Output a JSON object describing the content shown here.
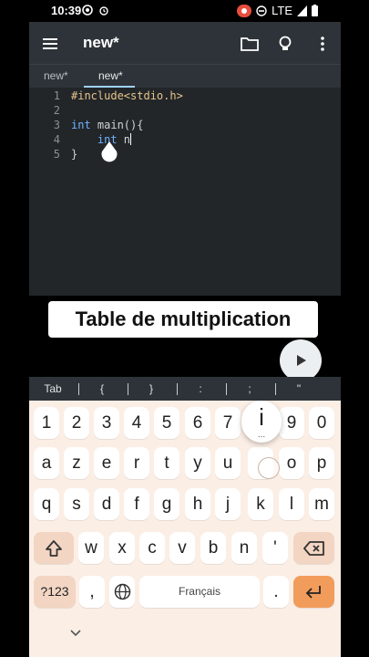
{
  "status_bar": {
    "time": "10:39",
    "network": "LTE",
    "icons": [
      "gear-icon",
      "alarm-icon",
      "record-icon",
      "dnd-icon",
      "signal-icon",
      "battery-icon"
    ]
  },
  "app": {
    "title": "new*",
    "toolbar_icons": [
      "menu-icon",
      "folder-icon",
      "lightbulb-icon",
      "more-vert-icon"
    ],
    "tabs": [
      {
        "label": "new*",
        "active": false
      },
      {
        "label": "new*",
        "active": true
      }
    ],
    "editor": {
      "line_numbers": [
        "1",
        "2",
        "3",
        "4",
        "5"
      ],
      "lines": [
        {
          "a": "#include<stdio.h>",
          "b": ""
        },
        {
          "a": "",
          "b": ""
        },
        {
          "a": "int",
          "b": " main(){"
        },
        {
          "a": "    int",
          "b": " n"
        },
        {
          "a": "",
          "b": "}"
        }
      ]
    }
  },
  "caption": "Table de multiplication",
  "run_button": {
    "icon": "play-icon"
  },
  "symbol_bar": {
    "items": [
      "Tab",
      "{",
      "}",
      ":",
      ";",
      "\""
    ]
  },
  "keyboard": {
    "row1": [
      "1",
      "2",
      "3",
      "4",
      "5",
      "6",
      "7",
      "8",
      "9",
      "0"
    ],
    "row2": [
      "a",
      "z",
      "e",
      "r",
      "t",
      "y",
      "u",
      "i",
      "o",
      "p"
    ],
    "row3": [
      "q",
      "s",
      "d",
      "f",
      "g",
      "h",
      "j",
      "k",
      "l",
      "m"
    ],
    "row4": [
      "w",
      "x",
      "c",
      "v",
      "b",
      "n",
      "'"
    ],
    "row5": {
      "sym": "?123",
      "comma": ",",
      "dot": ".",
      "space": "Français"
    },
    "popup": {
      "letter": "i",
      "dots": "..."
    },
    "colors": {
      "background": "#fbeee5",
      "special": "#f2d5c2",
      "action": "#f29c5b"
    }
  }
}
